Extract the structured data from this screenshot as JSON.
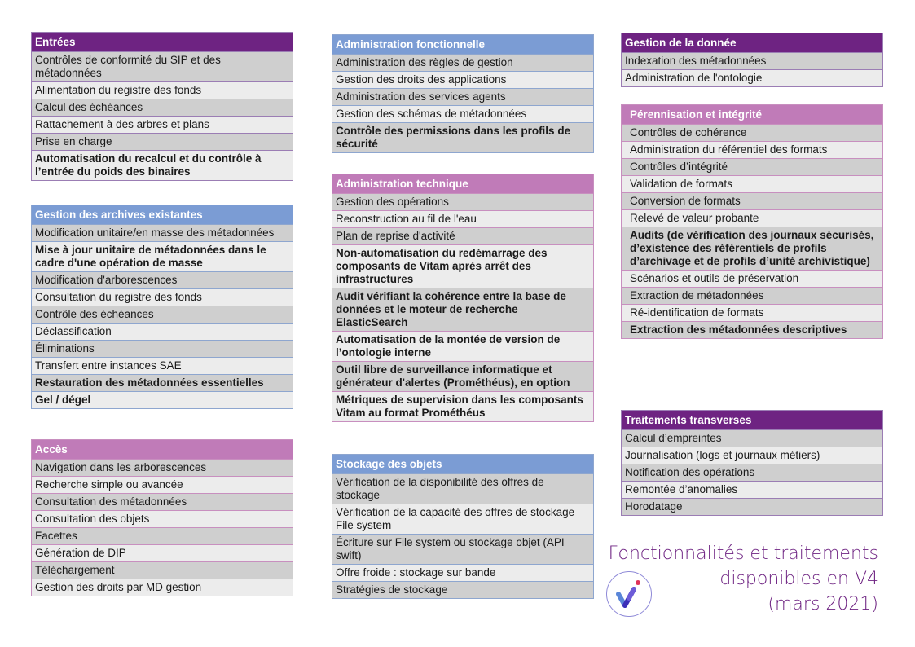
{
  "columns": [
    [
      {
        "title": "Entrées",
        "style": "purple",
        "items": [
          {
            "text": "Contrôles de conformité du SIP et des métadonnées",
            "bold": false
          },
          {
            "text": "Alimentation du registre des fonds",
            "bold": false
          },
          {
            "text": "Calcul des échéances",
            "bold": false
          },
          {
            "text": "Rattachement à des arbres et plans",
            "bold": false
          },
          {
            "text": "Prise en charge",
            "bold": false
          },
          {
            "text": "Automatisation du recalcul et du contrôle à l’entrée du poids des binaires",
            "bold": true
          }
        ]
      },
      {
        "title": "Gestion des archives existantes",
        "style": "blue",
        "items": [
          {
            "text": "Modification unitaire/en masse des métadonnées",
            "bold": false
          },
          {
            "text": "Mise à jour unitaire de métadonnées dans le cadre d'une opération de masse",
            "bold": true
          },
          {
            "text": "Modification d'arborescences",
            "bold": false
          },
          {
            "text": "Consultation du registre des fonds",
            "bold": false
          },
          {
            "text": "Contrôle des échéances",
            "bold": false
          },
          {
            "text": "Déclassification",
            "bold": false
          },
          {
            "text": "Éliminations",
            "bold": false
          },
          {
            "text": "Transfert entre instances SAE",
            "bold": false
          },
          {
            "text": "Restauration des métadonnées essentielles",
            "bold": true
          },
          {
            "text": "Gel / dégel",
            "bold": true
          }
        ]
      },
      {
        "title": "Accès",
        "style": "pink-left",
        "items": [
          {
            "text": "Navigation dans les arborescences",
            "bold": false
          },
          {
            "text": "Recherche simple ou avancée",
            "bold": false
          },
          {
            "text": "Consultation des métadonnées",
            "bold": false
          },
          {
            "text": "Consultation des objets",
            "bold": false
          },
          {
            "text": "Facettes",
            "bold": false
          },
          {
            "text": "Génération de DIP",
            "bold": false
          },
          {
            "text": "Téléchargement",
            "bold": false
          },
          {
            "text": "Gestion des droits par MD gestion",
            "bold": false
          }
        ]
      }
    ],
    [
      {
        "title": "Administration fonctionnelle",
        "style": "blue",
        "items": [
          {
            "text": "Administration des règles de gestion",
            "bold": false
          },
          {
            "text": "Gestion des droits des applications",
            "bold": false
          },
          {
            "text": "Administration des services agents",
            "bold": false
          },
          {
            "text": "Gestion des schémas de métadonnées",
            "bold": false
          },
          {
            "text": "Contrôle des permissions dans les profils de sécurité",
            "bold": true
          }
        ]
      },
      {
        "title": "Administration technique",
        "style": "pink-left",
        "items": [
          {
            "text": "Gestion des opérations",
            "bold": false
          },
          {
            "text": "Reconstruction au fil de l'eau",
            "bold": false
          },
          {
            "text": "Plan de reprise d'activité",
            "bold": false
          },
          {
            "text": "Non-automatisation du redémarrage des composants de Vitam après arrêt des infrastructures",
            "bold": true
          },
          {
            "text": "Audit vérifiant la cohérence entre la base de données et le moteur de recherche ElasticSearch",
            "bold": true
          },
          {
            "text": "Automatisation de la montée de version de l’ontologie interne",
            "bold": true
          },
          {
            "text": "Outil libre de surveillance informatique et générateur d'alertes (Prométhéus), en option",
            "bold": true
          },
          {
            "text": "Métriques de supervision dans les composants Vitam au format Prométhéus",
            "bold": true
          }
        ]
      },
      {
        "title": "Stockage des objets",
        "style": "blue",
        "items": [
          {
            "text": "Vérification de la disponibilité des offres de stockage",
            "bold": false
          },
          {
            "text": "Vérification de la capacité des offres de stockage File system",
            "bold": false
          },
          {
            "text": "Écriture sur File system ou stockage objet (API swift)",
            "bold": false
          },
          {
            "text": "Offre froide : stockage sur bande",
            "bold": false
          },
          {
            "text": "Stratégies de stockage",
            "bold": false
          }
        ]
      }
    ],
    [
      {
        "title": "Gestion de la donnée",
        "style": "purple",
        "items": [
          {
            "text": "Indexation des métadonnées",
            "bold": false
          },
          {
            "text": "Administration de l'ontologie",
            "bold": false
          }
        ]
      },
      {
        "title": "Pérennisation et intégrité",
        "style": "pink",
        "items": [
          {
            "text": "Contrôles de cohérence",
            "bold": false
          },
          {
            "text": "Administration du référentiel des formats",
            "bold": false
          },
          {
            "text": "Contrôles d’intégrité",
            "bold": false
          },
          {
            "text": "Validation de formats",
            "bold": false
          },
          {
            "text": "Conversion de formats",
            "bold": false
          },
          {
            "text": "Relevé de valeur probante",
            "bold": false
          },
          {
            "text": "Audits (de vérification des journaux sécurisés, d’existence des référentiels de profils d’archivage et de profils d’unité archivistique)",
            "bold": true
          },
          {
            "text": "Scénarios et outils de préservation",
            "bold": false
          },
          {
            "text": "Extraction de métadonnées",
            "bold": false
          },
          {
            "text": "Ré-identification de formats",
            "bold": false
          },
          {
            "text": "Extraction des métadonnées descriptives",
            "bold": true
          }
        ]
      },
      {
        "title": "Traitements transverses",
        "style": "purple",
        "items": [
          {
            "text": "Calcul d’empreintes",
            "bold": false
          },
          {
            "text": "Journalisation (logs et journaux métiers)",
            "bold": false
          },
          {
            "text": "Notification des opérations",
            "bold": false
          },
          {
            "text": "Remontée d’anomalies",
            "bold": false
          },
          {
            "text": "Horodatage",
            "bold": false
          }
        ]
      }
    ]
  ],
  "footer": {
    "title_lines": [
      "Fonctionnalités et traitements",
      "disponibles en V4",
      "(mars 2021)"
    ],
    "logo_icon": "vitam-check-logo-icon"
  },
  "colors": {
    "purple": "#6e2382",
    "blue": "#7b9cd4",
    "pink": "#c07bb8",
    "row_dark": "#cfcfcf",
    "row_light": "#ececec"
  }
}
